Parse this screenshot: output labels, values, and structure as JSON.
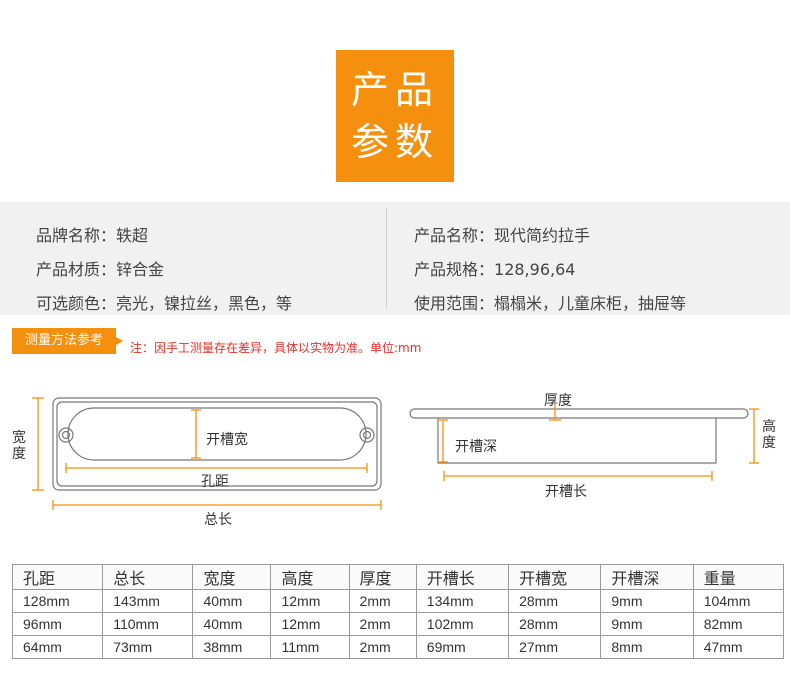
{
  "title": {
    "line1": "产品",
    "line2": "参数"
  },
  "info": {
    "left": [
      {
        "label": "品牌名称：",
        "value": "轶超"
      },
      {
        "label": "产品材质：",
        "value": "锌合金"
      },
      {
        "label": "可选颜色：",
        "value": "亮光，镍拉丝，黑色，等"
      }
    ],
    "right": [
      {
        "label": "产品名称：",
        "value": "现代简约拉手"
      },
      {
        "label": "产品规格：",
        "value": "128,96,64"
      },
      {
        "label": "使用范围：",
        "value": "榻榻米，儿童床柜，抽屉等"
      }
    ]
  },
  "note": {
    "tag": "测量方法参考",
    "text": "注：因手工测量存在差异，具体以实物为准。单位:mm"
  },
  "diagram": {
    "width_label": "宽\n度",
    "slot_width": "开槽宽",
    "hole_distance": "孔距",
    "total_length": "总长",
    "thickness": "厚度",
    "slot_depth": "开槽深",
    "height_label": "高\n度",
    "slot_length": "开槽长"
  },
  "colors": {
    "accent": "#f5900f",
    "note": "#e4302b"
  },
  "table": {
    "headers": [
      "孔距",
      "总长",
      "宽度",
      "高度",
      "厚度",
      "开槽长",
      "开槽宽",
      "开槽深",
      "重量"
    ],
    "rows": [
      [
        "128mm",
        "143mm",
        "40mm",
        "12mm",
        "2mm",
        "134mm",
        "28mm",
        "9mm",
        "104mm"
      ],
      [
        "96mm",
        "110mm",
        "40mm",
        "12mm",
        "2mm",
        "102mm",
        "28mm",
        "9mm",
        "82mm"
      ],
      [
        "64mm",
        "73mm",
        "38mm",
        "11mm",
        "2mm",
        "69mm",
        "27mm",
        "8mm",
        "47mm"
      ]
    ]
  }
}
